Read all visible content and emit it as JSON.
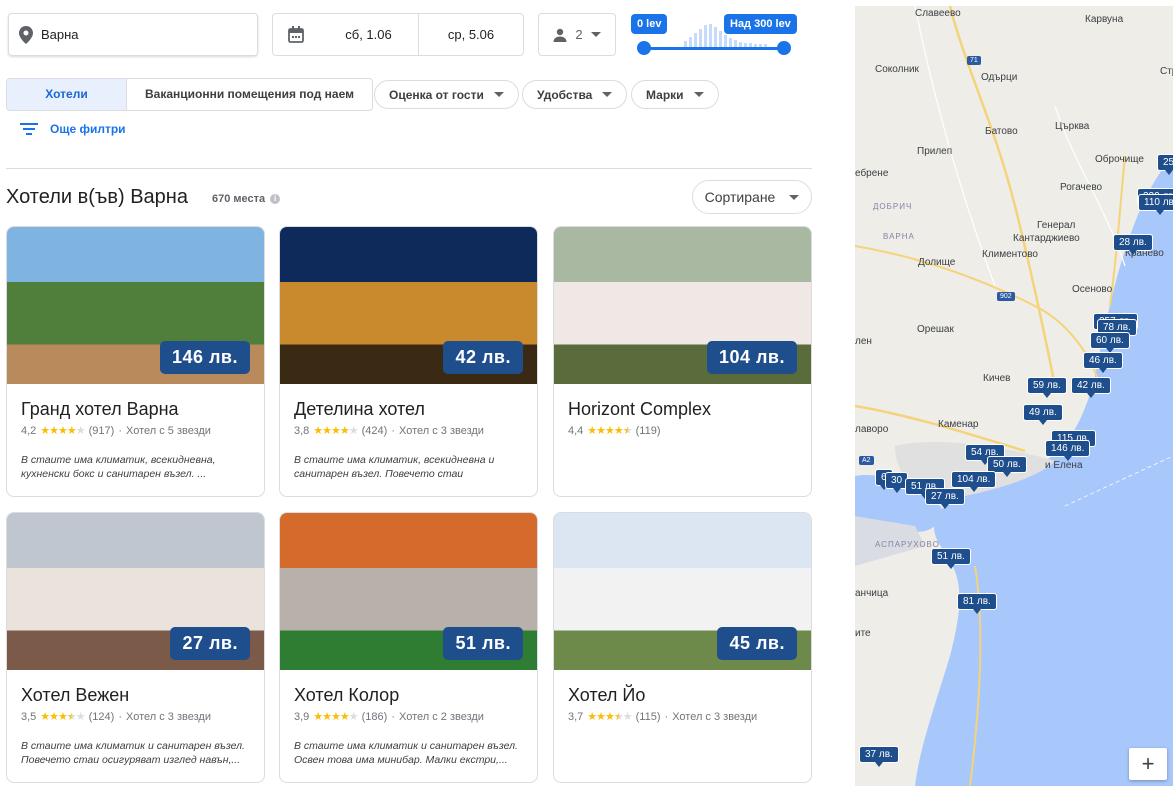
{
  "search": {
    "location": "Варна",
    "check_in": "сб, 1.06",
    "check_out": "ср, 5.06",
    "guests": "2",
    "price_min_label": "0 lev",
    "price_max_label": "Над 300 lev"
  },
  "filters": {
    "segment": [
      "Хотели",
      "Ваканционни помещения под наем"
    ],
    "chips": [
      "Оценка от гости",
      "Удобства",
      "Марки"
    ],
    "more": "Още филтри"
  },
  "results": {
    "title": "Хотели в(ъв) Варна",
    "count": "670 места",
    "sort": "Сортиране"
  },
  "hotels": [
    {
      "name": "Гранд хотел Варна",
      "price": "146 лв.",
      "rating": "4,2",
      "stars": 4,
      "reviews": "(917)",
      "class": "Хотел с 5 звезди",
      "desc": "В стаите има климатик, всекидневна, кухненски бокс и санитарен възел. ...",
      "img": [
        "#7fb3e0",
        "#4f7f3a",
        "#b98a5b"
      ]
    },
    {
      "name": "Детелина хотел",
      "price": "42 лв.",
      "rating": "3,8",
      "stars": 4,
      "reviews": "(424)",
      "class": "Хотел с 3 звезди",
      "desc": "В стаите има климатик, всекидневна и санитарен възел. Повечето стаи осигурява...",
      "img": [
        "#0e2a5a",
        "#c98a2e",
        "#3a2a14"
      ]
    },
    {
      "name": "Horizont Complex",
      "price": "104 лв.",
      "rating": "4,4",
      "stars": 4.5,
      "reviews": "(119)",
      "class": "",
      "desc": "",
      "img": [
        "#a9b8a0",
        "#efe8e4",
        "#5a6b3c"
      ]
    },
    {
      "name": "Хотел Вежен",
      "price": "27 лв.",
      "rating": "3,5",
      "stars": 3.5,
      "reviews": "(124)",
      "class": "Хотел с 3 звезди",
      "desc": "В стаите има климатик и санитарен възел. Повечето стаи осигуряват изглед навън,...",
      "img": [
        "#c0c6cf",
        "#e9e3dc",
        "#7b5a4a"
      ]
    },
    {
      "name": "Хотел Колор",
      "price": "51 лв.",
      "rating": "3,9",
      "stars": 4,
      "reviews": "(186)",
      "class": "Хотел с 2 звезди",
      "desc": "В стаите има климатик и санитарен възел. Освен това има минибар. Малки екстри,...",
      "img": [
        "#d46a2c",
        "#b7b1aa",
        "#2e7d32"
      ]
    },
    {
      "name": "Хотел Йо",
      "price": "45 лв.",
      "rating": "3,7",
      "stars": 3.5,
      "reviews": "(115)",
      "class": "Хотел с 3 звезди",
      "desc": "",
      "img": [
        "#dbe6f2",
        "#f2f2f2",
        "#6e8a4a"
      ]
    }
  ],
  "map": {
    "places": [
      "Славеево",
      "Карвуна",
      "Соколник",
      "Одърци",
      "Стр",
      "Батово",
      "Църква",
      "Прилеп",
      "Оброчище",
      "ебрене",
      "Рогачево",
      "Генерал",
      "Кантарджиево",
      "Климентово",
      "Кранево",
      "Долище",
      "Осеново",
      "Орешак",
      "лен",
      "Кичев",
      "Каменар",
      "лаворо",
      "и Елена",
      "анчица",
      "ите"
    ],
    "regions": [
      "ДОБРИЧ",
      "ВАРНА",
      "АСПАРУХОВО"
    ],
    "roads": [
      "71",
      "902",
      "A2"
    ],
    "pins": [
      "25",
      "220 лв.",
      "110 лв.",
      "28 лв.",
      "257 лв.",
      "78 лв.",
      "60 лв.",
      "46 лв.",
      "59 лв.",
      "42 лв.",
      "49 лв.",
      "115 лв.",
      "146 лв.",
      "54 лв.",
      "50 лв.",
      "6",
      "30",
      "51 лв.",
      "104 лв.",
      "27 лв.",
      "51 лв.",
      "81 лв.",
      "37 лв."
    ],
    "zoom": "+"
  }
}
